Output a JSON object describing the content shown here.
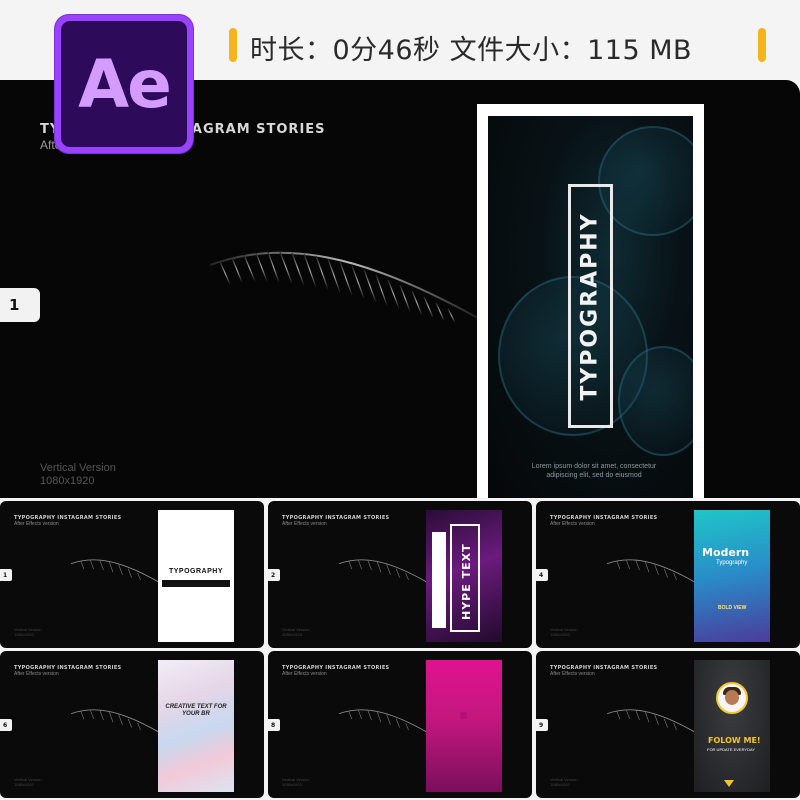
{
  "header": {
    "logo_text": "Ae",
    "info_text": "时长：0分46秒  文件大小：115 MB",
    "accent_color": "#f4b41a",
    "logo_color": "#9a43ff"
  },
  "hero": {
    "title": "TYPOGRAPHY INSTAGRAM STORIES",
    "subtitle": "After Effects version",
    "number": "1",
    "version": "Vertical Version",
    "resolution": "1080x1920",
    "phone_word": "TYPOGRAPHY",
    "lorem": "Lorem ipsum dolor sit amet, consectetur adipiscing elit, sed do eiusmod"
  },
  "thumbs": [
    {
      "number": "1",
      "title": "TYPOGRAPHY INSTAGRAM STORIES",
      "subtitle": "After Effects version",
      "version": "Vertical Version",
      "resolution": "1080x1920",
      "text": "TYPOGRAPHY"
    },
    {
      "number": "2",
      "title": "TYPOGRAPHY INSTAGRAM STORIES",
      "subtitle": "After Effects version",
      "version": "Vertical Version",
      "resolution": "1080x1920",
      "text": "HYPE TEXT"
    },
    {
      "number": "4",
      "title": "TYPOGRAPHY INSTAGRAM STORIES",
      "subtitle": "After Effects version",
      "version": "Vertical Version",
      "resolution": "1080x1920",
      "text": "Modern",
      "text2": "Typography",
      "text3": "BOLD VIEW"
    },
    {
      "number": "6",
      "title": "TYPOGRAPHY INSTAGRAM STORIES",
      "subtitle": "After Effects version",
      "version": "Vertical Version",
      "resolution": "1080x1920",
      "text": "CREATIVE TEXT FOR YOUR BR"
    },
    {
      "number": "8",
      "title": "TYPOGRAPHY INSTAGRAM STORIES",
      "subtitle": "After Effects version",
      "version": "Vertical Version",
      "resolution": "1080x1920"
    },
    {
      "number": "9",
      "title": "TYPOGRAPHY INSTAGRAM STORIES",
      "subtitle": "After Effects version",
      "version": "Vertical Version",
      "resolution": "1080x1920",
      "text": "FOLOW ME!",
      "text2": "FOR UPDATE EVERYDAY"
    }
  ]
}
